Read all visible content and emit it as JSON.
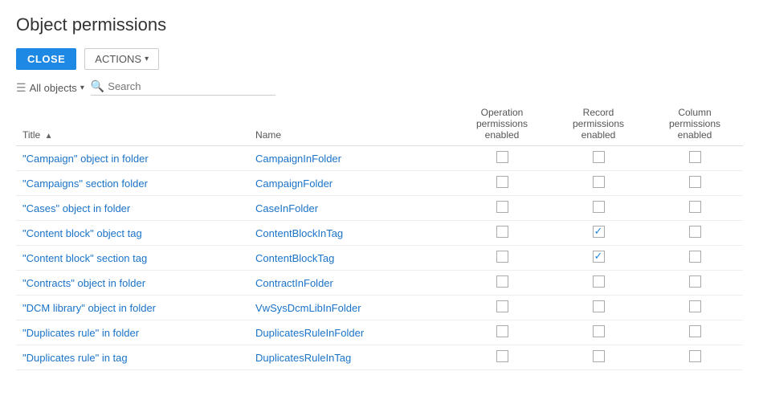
{
  "page": {
    "title": "Object permissions"
  },
  "toolbar": {
    "close_label": "CLOSE",
    "actions_label": "ACTIONS"
  },
  "filter": {
    "all_objects_label": "All objects",
    "search_placeholder": "Search"
  },
  "table": {
    "columns": [
      {
        "id": "title",
        "label": "Title",
        "sortable": true
      },
      {
        "id": "name",
        "label": "Name",
        "sortable": false
      },
      {
        "id": "operation",
        "label": "Operation permissions enabled",
        "sortable": false
      },
      {
        "id": "record",
        "label": "Record permissions enabled",
        "sortable": false
      },
      {
        "id": "column",
        "label": "Column permissions enabled",
        "sortable": false
      }
    ],
    "rows": [
      {
        "title": "\"Campaign\" object in folder",
        "name": "CampaignInFolder",
        "operation": false,
        "record": false,
        "column": false
      },
      {
        "title": "\"Campaigns\" section folder",
        "name": "CampaignFolder",
        "operation": false,
        "record": false,
        "column": false
      },
      {
        "title": "\"Cases\" object in folder",
        "name": "CaseInFolder",
        "operation": false,
        "record": false,
        "column": false
      },
      {
        "title": "\"Content block\" object tag",
        "name": "ContentBlockInTag",
        "operation": false,
        "record": true,
        "column": false
      },
      {
        "title": "\"Content block\" section tag",
        "name": "ContentBlockTag",
        "operation": false,
        "record": true,
        "column": false
      },
      {
        "title": "\"Contracts\" object in folder",
        "name": "ContractInFolder",
        "operation": false,
        "record": false,
        "column": false
      },
      {
        "title": "\"DCM library\" object in folder",
        "name": "VwSysDcmLibInFolder",
        "operation": false,
        "record": false,
        "column": false
      },
      {
        "title": "\"Duplicates rule\" in folder",
        "name": "DuplicatesRuleInFolder",
        "operation": false,
        "record": false,
        "column": false
      },
      {
        "title": "\"Duplicates rule\" in tag",
        "name": "DuplicatesRuleInTag",
        "operation": false,
        "record": false,
        "column": false
      }
    ]
  }
}
